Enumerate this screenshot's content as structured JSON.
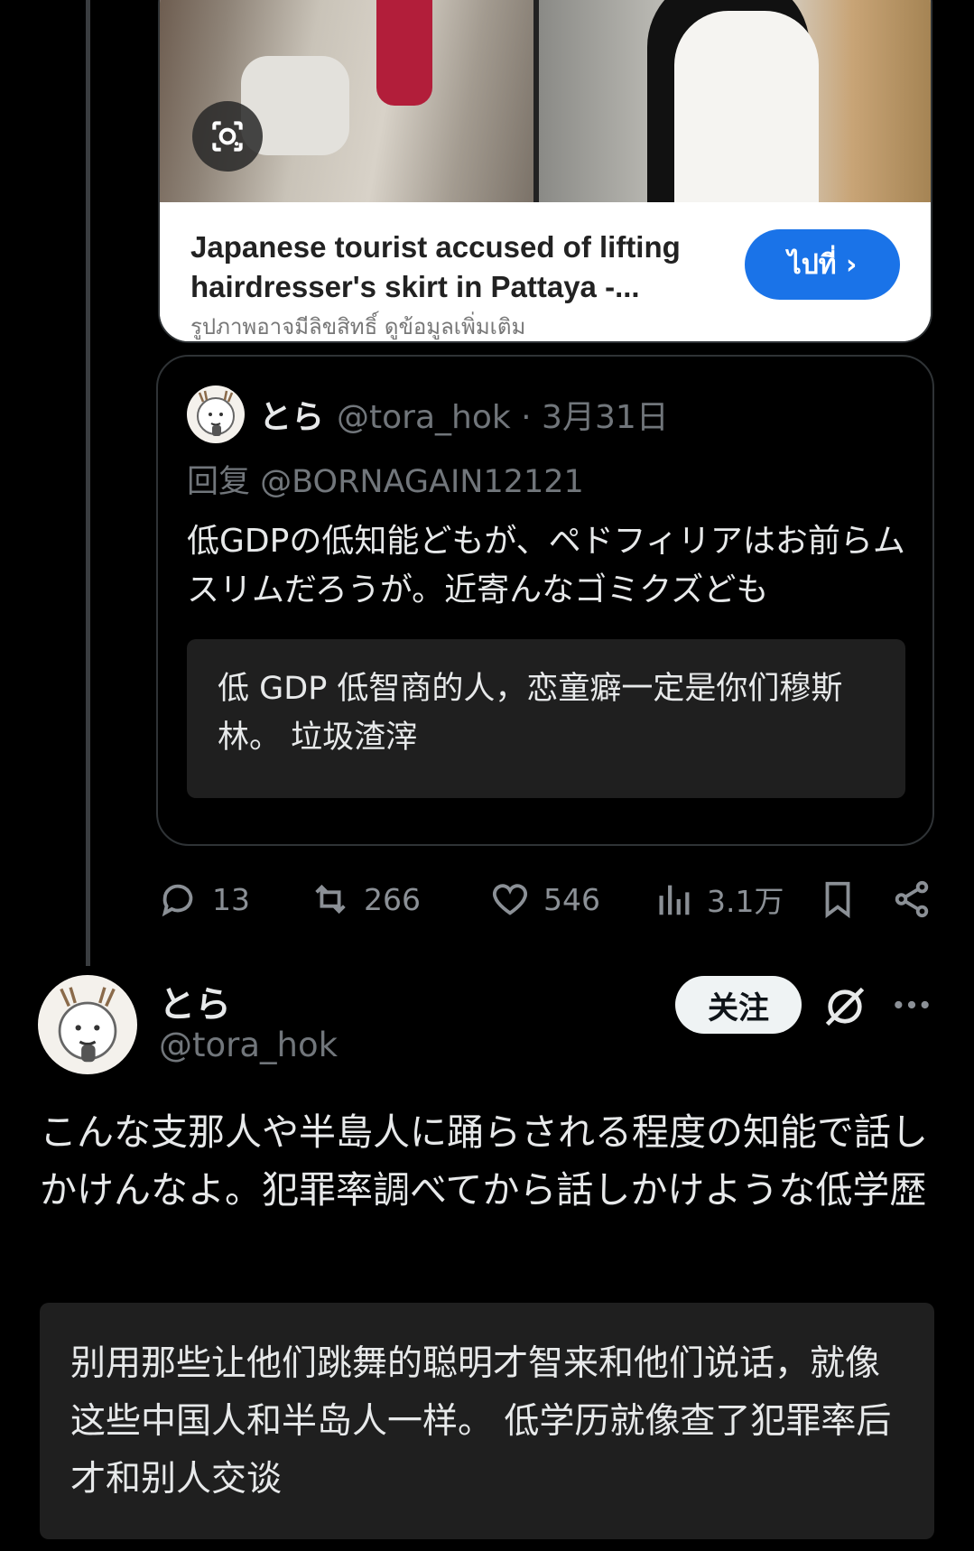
{
  "link_card": {
    "title": "Japanese tourist accused of lifting hairdresser's skirt in Pattaya -...",
    "image_note": "รูปภาพอาจมีลิขสิทธิ์ ดูข้อมูลเพิ่มเติม",
    "goto_label": "ไปที่ ›",
    "lens_icon": "camera-lens-icon"
  },
  "quoted_tweet": {
    "name": "とら",
    "handle_date": "@tora_hok · 3月31日",
    "reply_to": "回复 @BORNAGAIN12121",
    "text": "低GDPの低知能どもが、ペドフィリアはお前らムスリムだろうが。近寄んなゴミクズども",
    "translation": "低 GDP 低智商的人，恋童癖一定是你们穆斯林。 垃圾渣滓"
  },
  "actions": {
    "replies": "13",
    "retweets": "266",
    "likes": "546",
    "views": "3.1万"
  },
  "main_tweet": {
    "name": "とら",
    "handle": "@tora_hok",
    "follow_label": "关注",
    "text": "こんな支那人や半島人に踊らされる程度の知能で話しかけんなよ。犯罪率調べてから話しかけような低学歴",
    "translation": "别用那些让他们跳舞的聪明才智来和他们说话，就像这些中国人和半岛人一样。 低学历就像查了犯罪率后才和别人交谈"
  },
  "colors": {
    "background": "#000000",
    "text": "#e7e9ea",
    "muted": "#71767b",
    "link_button": "#1a73e8",
    "translation_box": "#1f1f1f"
  }
}
